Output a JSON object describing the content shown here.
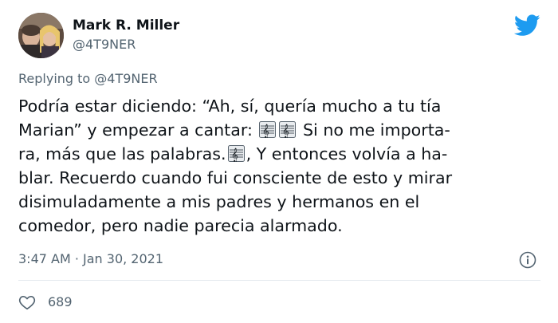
{
  "author": {
    "name": "Mark R. Miller",
    "handle": "@4T9NER",
    "avatar_icon": "profile-photo"
  },
  "brand": {
    "icon": "twitter-bird-icon",
    "color": "#1d9bf0"
  },
  "reply": {
    "prefix": "Replying to ",
    "handle": "@4T9NER"
  },
  "tweet": {
    "lines": [
      [
        "Podría estar diciendo: “Ah, sí, quería mucho a tu tía"
      ],
      [
        "Marian” y empezar a cantar: ",
        " Si no me importa-"
      ],
      [
        "ra, más que las palabras.",
        ",  Y entonces volvía a ha-"
      ],
      [
        "blar. Recuerdo cuando fui consciente de esto y mirar"
      ],
      [
        "disimuladamente a mis padres y hermanos en el"
      ],
      [
        "comedor, pero nadie parecia alarmado."
      ]
    ],
    "emoji": "musical-score-icon"
  },
  "meta": {
    "timestamp": "3:47 AM · Jan 30, 2021",
    "likes": "689"
  },
  "colors": {
    "text": "#0f1419",
    "secondary": "#536471",
    "divider": "#e5eaee"
  }
}
